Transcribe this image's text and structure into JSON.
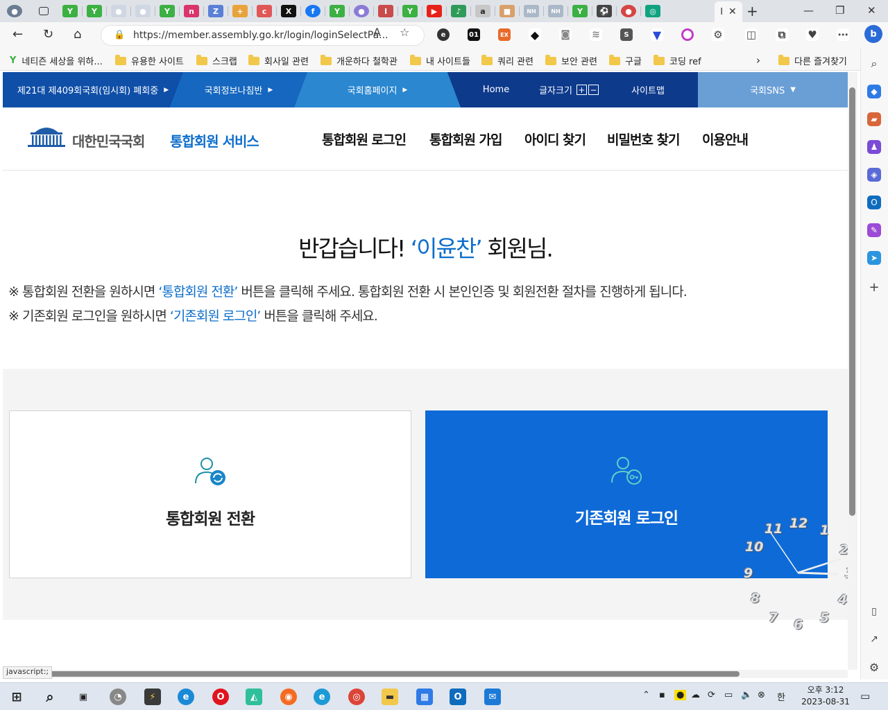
{
  "browser": {
    "active_tab_label": "I",
    "url": "https://member.assembly.go.kr/login/loginSelectPa...",
    "status_text": "javascript:;",
    "ext_labels": [
      "01",
      "EX",
      "S"
    ],
    "bookmarks": [
      "네티즌 세상을 위하...",
      "유용한 사이트",
      "스크랩",
      "회사일 관련",
      "개운하다 철학관",
      "내 사이트들",
      "쿼리 관련",
      "보안 관련",
      "구글",
      "코딩 ref"
    ],
    "other_bookmarks": "다른 즐겨찾기"
  },
  "topnav": {
    "session": "제21대 제409회국회(임시회) 폐회중",
    "info": "국회정보나침반",
    "home_page": "국회홈페이지",
    "home": "Home",
    "font_size": "글자크기",
    "sitemap": "사이트맵",
    "sns": "국회SNS"
  },
  "header": {
    "org": "대한민국국회",
    "service": "통합회원 서비스",
    "menu": [
      "통합회원 로그인",
      "통합회원 가입",
      "아이디 찾기",
      "비밀번호 찾기",
      "이용안내"
    ]
  },
  "welcome": {
    "prefix": "반갑습니다!",
    "name": "‘이윤찬’",
    "suffix": "회원님."
  },
  "notes": {
    "line1_a": "※ 통합회원 전환을 원하시면",
    "line1_hl": "‘통합회원 전환’",
    "line1_b": "버튼을 클릭해 주세요. 통합회원 전환 시 본인인증 및 회원전환 절차를 진행하게 됩니다.",
    "line2_a": "※ 기존회원 로그인을 원하시면",
    "line2_hl": "‘기존회원 로그인’",
    "line2_b": "버튼을 클릭해 주세요."
  },
  "cards": {
    "convert": "통합회원 전환",
    "legacy_login": "기존회원 로그인"
  },
  "desktop_clock_numbers": [
    "11",
    "12",
    "1",
    "10",
    "2",
    "9",
    "3",
    "8",
    "4",
    "7",
    "6",
    "5"
  ],
  "taskbar": {
    "time": "오후 3:12",
    "date": "2023-08-31",
    "ime": "한"
  },
  "colors": {
    "brand_blue": "#0d6ecb",
    "nav_dark": "#0e3a8c",
    "card_blue": "#0e6ad7"
  }
}
